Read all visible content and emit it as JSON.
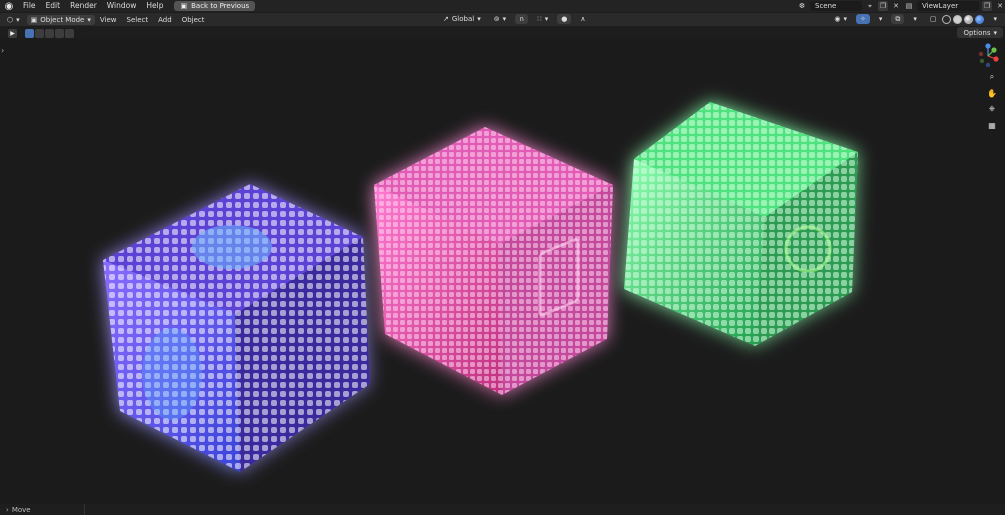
{
  "topbar": {
    "menus": [
      "File",
      "Edit",
      "Render",
      "Window",
      "Help"
    ],
    "back_button": "Back to Previous",
    "scene_name": "Scene",
    "view_layer_name": "ViewLayer"
  },
  "viewport_header": {
    "mode": "Object Mode",
    "menus": [
      "View",
      "Select",
      "Add",
      "Object"
    ],
    "orientation": "Global"
  },
  "tool_settings": {
    "options_label": "Options"
  },
  "status_bar": {
    "operator": "Move"
  },
  "scene_objects": [
    {
      "name": "purple-cube",
      "color": "#7b5cff"
    },
    {
      "name": "pink-cube",
      "color": "#ff5fc8"
    },
    {
      "name": "green-cube",
      "color": "#4dff8a"
    }
  ],
  "colors": {
    "background": "#1b1b1b",
    "accent": "#4772b3",
    "header": "#2a2a2a"
  }
}
